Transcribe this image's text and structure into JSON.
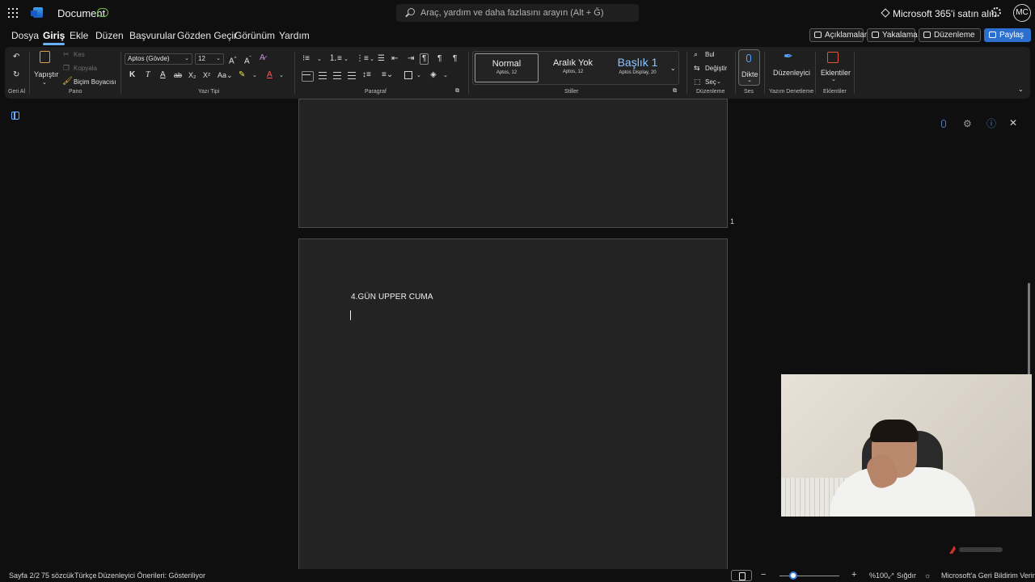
{
  "titlebar": {
    "document_title": "Document",
    "search_placeholder": "Araç, yardım ve daha fazlasını arayın (Alt + Ğ)",
    "buy_label": "Microsoft 365'i satın alın",
    "avatar_initials": "MC"
  },
  "menu": {
    "tabs": [
      "Dosya",
      "Giriş",
      "Ekle",
      "Düzen",
      "Başvurular",
      "Gözden Geçir",
      "Görünüm",
      "Yardım"
    ],
    "active_tab": "Giriş",
    "comments_label": "Açıklamalar",
    "catch_up_label": "Yakalama",
    "editing_label": "Düzenleme",
    "share_label": "Paylaş"
  },
  "ribbon": {
    "undo_group": "Geri Al",
    "clipboard": {
      "paste": "Yapıştır",
      "cut": "Kes",
      "copy": "Kopyala",
      "format_painter": "Biçim Boyacısı",
      "group": "Pano"
    },
    "font": {
      "name": "Aptos (Gövde)",
      "size": "12",
      "group": "Yazı Tipi",
      "bold": "K",
      "italic": "T",
      "underline": "A",
      "strike": "ab"
    },
    "paragraph": {
      "group": "Paragraf"
    },
    "styles": {
      "group": "Stiller",
      "items": [
        {
          "name": "Normal",
          "sub": "Aptos, 12"
        },
        {
          "name": "Aralık Yok",
          "sub": "Aptos, 12"
        },
        {
          "name": "Başlık 1",
          "sub": "Aptos Display, 20"
        }
      ]
    },
    "editing": {
      "find": "Bul",
      "replace": "Değiştir",
      "select": "Seç",
      "group": "Düzenleme"
    },
    "voice": {
      "dictate": "Dikte",
      "group": "Ses"
    },
    "editor": {
      "label": "Düzenleyici",
      "group": "Yazım Denetleme"
    },
    "addins": {
      "label": "Eklentiler",
      "group": "Eklentiler"
    }
  },
  "document": {
    "page_number": "1",
    "text": "4.GÜN UPPER CUMA"
  },
  "status": {
    "page": "Sayfa 2/2",
    "words": "75 sözcük",
    "language": "Türkçe",
    "editor_suggestions": "Düzenleyici Önerileri: Gösteriliyor",
    "zoom": "%100",
    "fit": "Sığdır",
    "feedback": "Microsoft'a Geri Bildirim Verin"
  }
}
